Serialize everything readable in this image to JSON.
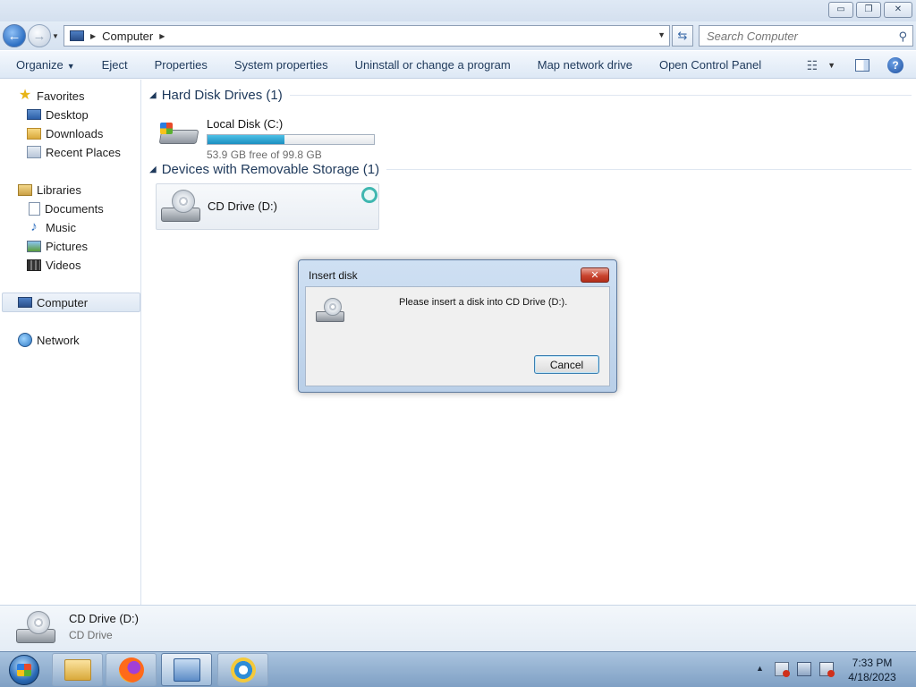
{
  "window": {
    "controls": {
      "minimize": "▭",
      "maximize": "❐",
      "close": "✕"
    }
  },
  "address": {
    "crumb": "Computer",
    "search_placeholder": "Search Computer"
  },
  "toolbar": {
    "organize": "Organize",
    "eject": "Eject",
    "properties": "Properties",
    "system_properties": "System properties",
    "uninstall": "Uninstall or change a program",
    "map_drive": "Map network drive",
    "control_panel": "Open Control Panel",
    "help": "?"
  },
  "nav": {
    "favorites": "Favorites",
    "desktop": "Desktop",
    "downloads": "Downloads",
    "recent": "Recent Places",
    "libraries": "Libraries",
    "documents": "Documents",
    "music": "Music",
    "pictures": "Pictures",
    "videos": "Videos",
    "computer": "Computer",
    "network": "Network"
  },
  "groups": {
    "hdd_title": "Hard Disk Drives (1)",
    "removable_title": "Devices with Removable Storage (1)"
  },
  "local_disk": {
    "name": "Local Disk (C:)",
    "free_text": "53.9 GB free of 99.8 GB",
    "used_fraction": 0.46
  },
  "cd_drive": {
    "name": "CD Drive (D:)"
  },
  "details": {
    "name": "CD Drive (D:)",
    "type": "CD Drive"
  },
  "dialog": {
    "title": "Insert disk",
    "message": "Please insert a disk into CD Drive (D:).",
    "cancel": "Cancel",
    "close": "✕"
  },
  "taskbar": {
    "time": "7:33 PM",
    "date": "4/18/2023"
  },
  "icons": {
    "back": "back-arrow-icon",
    "forward": "forward-arrow-icon",
    "refresh": "refresh-icon",
    "search": "search-icon",
    "help": "help-icon"
  }
}
